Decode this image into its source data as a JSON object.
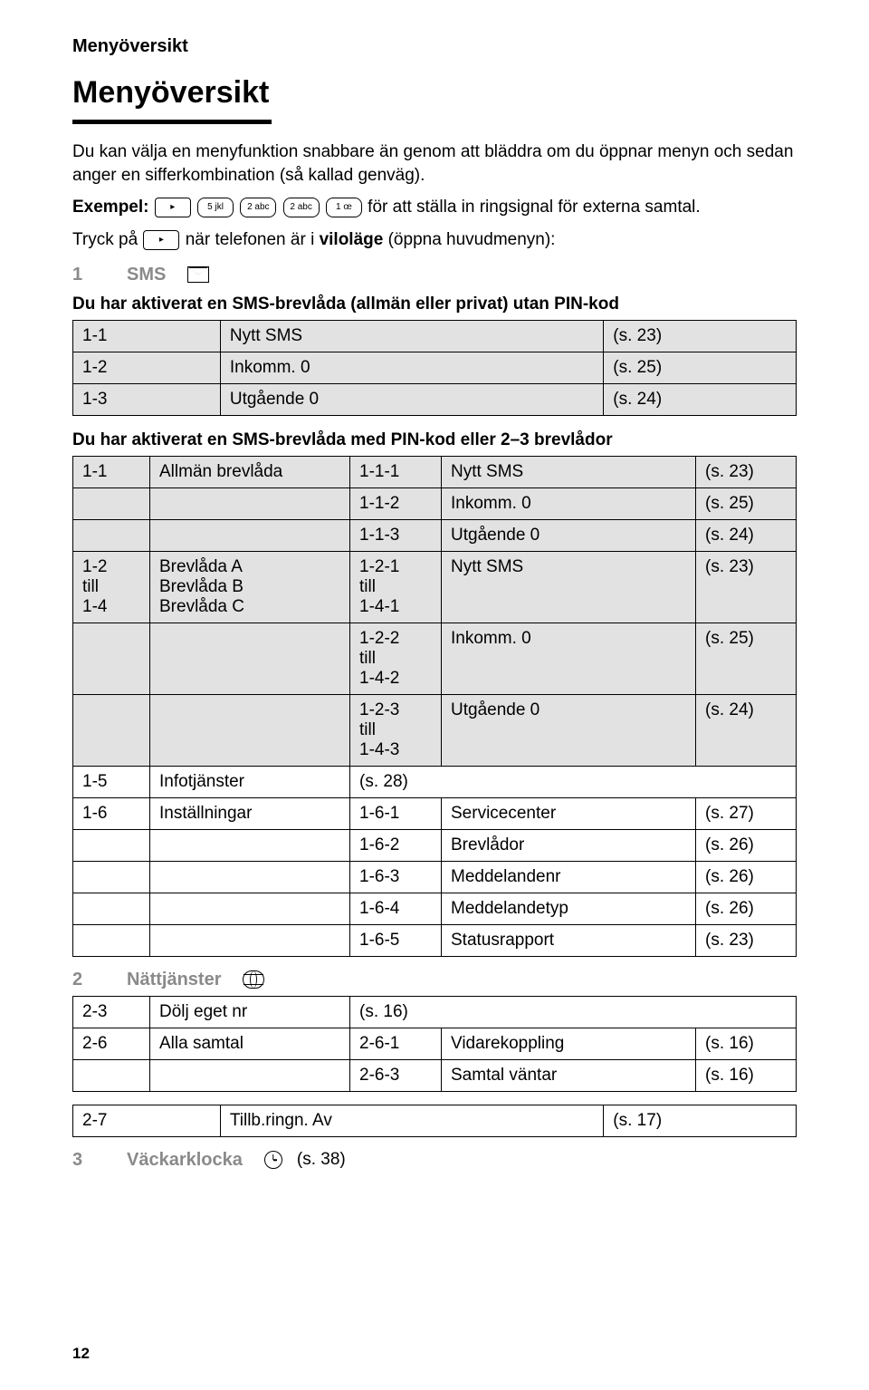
{
  "running_head": "Menyöversikt",
  "title": "Menyöversikt",
  "intro": "Du kan välja en menyfunktion snabbare än genom att bläddra om du öppnar menyn och sedan anger en sifferkombination (så kallad genväg).",
  "example_lead": "Exempel:",
  "example_keys": {
    "k1": "5 jkl",
    "k2": "2 abc",
    "k3": "2 abc",
    "k4": "1 œ"
  },
  "example_tail": "för att ställa in ringsignal för externa samtal.",
  "press_lead": "Tryck på",
  "press_tail_a": "när telefonen är i ",
  "press_bold": "viloläge",
  "press_tail_b": " (öppna huvudmenyn):",
  "sec1": {
    "num": "1",
    "name": "SMS"
  },
  "sub1": "Du har aktiverat en SMS-brevlåda (allmän eller privat) utan PIN-kod",
  "t1": {
    "r1": {
      "a": "1-1",
      "b": "Nytt SMS",
      "c": "(s. 23)"
    },
    "r2": {
      "a": "1-2",
      "b": "Inkomm.  0",
      "c": "(s. 25)"
    },
    "r3": {
      "a": "1-3",
      "b": "Utgående  0",
      "c": "(s. 24)"
    }
  },
  "sub2": "Du har aktiverat en SMS-brevlåda med PIN-kod eller 2–3 brevlådor",
  "t2": {
    "r1": {
      "a": "1-1",
      "b": "Allmän brevlåda",
      "c": "1-1-1",
      "d": "Nytt SMS",
      "e": "(s. 23)"
    },
    "r2": {
      "c": "1-1-2",
      "d": "Inkomm.  0",
      "e": "(s. 25)"
    },
    "r3": {
      "c": "1-1-3",
      "d": "Utgående  0",
      "e": "(s. 24)"
    },
    "r4": {
      "a": "1-2\ntill\n1-4",
      "b": "Brevlåda A\nBrevlåda B\nBrevlåda C",
      "c": "1-2-1\ntill\n1-4-1",
      "d": "Nytt SMS",
      "e": "(s. 23)"
    },
    "r5": {
      "c": "1-2-2\ntill\n1-4-2",
      "d": "Inkomm.  0",
      "e": "(s. 25)"
    },
    "r6": {
      "c": "1-2-3\ntill\n1-4-3",
      "d": "Utgående  0",
      "e": "(s. 24)"
    },
    "r7": {
      "a": "1-5",
      "b": "Infotjänster",
      "c": "(s. 28)"
    },
    "r8": {
      "a": "1-6",
      "b": "Inställningar",
      "c": "1-6-1",
      "d": "Servicecenter",
      "e": "(s. 27)"
    },
    "r9": {
      "c": "1-6-2",
      "d": "Brevlådor",
      "e": "(s. 26)"
    },
    "r10": {
      "c": "1-6-3",
      "d": "Meddelandenr",
      "e": "(s. 26)"
    },
    "r11": {
      "c": "1-6-4",
      "d": "Meddelandetyp",
      "e": "(s. 26)"
    },
    "r12": {
      "c": "1-6-5",
      "d": "Statusrapport",
      "e": "(s. 23)"
    }
  },
  "sec2": {
    "num": "2",
    "name": "Nättjänster"
  },
  "t3": {
    "r1": {
      "a": "2-3",
      "b": "Dölj eget nr",
      "c": "(s. 16)"
    },
    "r2": {
      "a": "2-6",
      "b": "Alla samtal",
      "c": "2-6-1",
      "d": "Vidarekoppling",
      "e": "(s. 16)"
    },
    "r3": {
      "c": "2-6-3",
      "d": "Samtal väntar",
      "e": "(s. 16)"
    },
    "r4": {
      "a": "2-7",
      "b": "Tillb.ringn. Av",
      "c": "(s. 17)"
    }
  },
  "sec3": {
    "num": "3",
    "name": "Väckarklocka",
    "pg": "(s. 38)"
  },
  "page_number": "12"
}
